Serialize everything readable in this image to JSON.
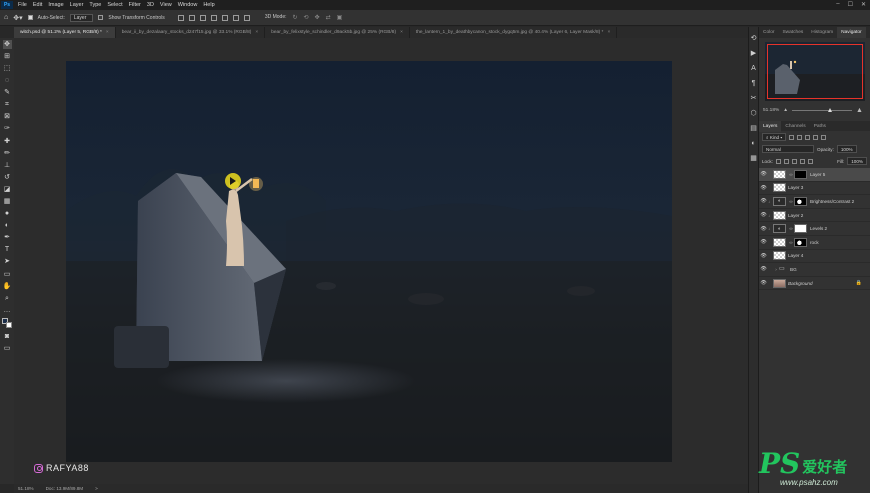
{
  "app": {
    "logo": "Ps"
  },
  "menu": [
    "File",
    "Edit",
    "Image",
    "Layer",
    "Type",
    "Select",
    "Filter",
    "3D",
    "View",
    "Window",
    "Help"
  ],
  "window_controls": [
    "–",
    "☐",
    "✕"
  ],
  "options_bar": {
    "auto_select_label": "Auto-Select:",
    "auto_select_target": "Layer",
    "transform_controls_label": "Show Transform Controls",
    "mode_3d_label": "3D Mode:"
  },
  "tabs": [
    {
      "label": "witch.psd @ 51.2% (Layer 5, RGB/8) *",
      "active": true
    },
    {
      "label": "bear_ii_by_dezalaary_stocks_d247f15.jpg @ 33.1% (RGB/8)",
      "active": false
    },
    {
      "label": "bear_by_felixstyle_schindler_d9ack5b.jpg @ 25% (RGB/8)",
      "active": false
    },
    {
      "label": "the_lantern_1_by_deathbycanon_stock_dygq5m.jpg @ 40.4% (Layer 6, Layer Mask/8) *",
      "active": false
    }
  ],
  "tools": [
    "move-icon",
    "artboard-icon",
    "marquee-icon",
    "lasso-icon",
    "quick-select-icon",
    "crop-icon",
    "frame-icon",
    "eyedropper-icon",
    "healing-icon",
    "brush-icon",
    "stamp-icon",
    "history-brush-icon",
    "eraser-icon",
    "gradient-icon",
    "blur-icon",
    "dodge-icon",
    "pen-icon",
    "type-icon",
    "path-select-icon",
    "shape-icon",
    "hand-icon",
    "zoom-icon",
    "more-icon"
  ],
  "tool_glyphs": [
    "✥",
    "⊞",
    "⬚",
    "◌",
    "✎",
    "⌗",
    "⊠",
    "✑",
    "✚",
    "✏",
    "⊥",
    "↺",
    "◪",
    "▦",
    "●",
    "◐",
    "✒",
    "T",
    "➤",
    "▭",
    "✋",
    "⌕",
    "…"
  ],
  "watermark": {
    "handle": "RAFYA88"
  },
  "status": {
    "zoom": "51.18%",
    "doc": "Doc: 13.9M/89.8M",
    "arrow": ">"
  },
  "panel_tabs": [
    {
      "label": "Color",
      "active": false
    },
    {
      "label": "Swatches",
      "active": false
    },
    {
      "label": "Histogram",
      "active": false
    },
    {
      "label": "Navigator",
      "active": true
    }
  ],
  "navigator": {
    "zoom": "51.18%"
  },
  "layer_tabs": [
    {
      "label": "Layers",
      "active": true
    },
    {
      "label": "Channels",
      "active": false
    },
    {
      "label": "Paths",
      "active": false
    }
  ],
  "layer_controls": {
    "kind_label": "Kind",
    "blend_mode": "Normal",
    "opacity_label": "Opacity:",
    "opacity_value": "100%",
    "lock_label": "Lock:",
    "fill_label": "Fill:",
    "fill_value": "100%"
  },
  "layers": [
    {
      "name": "Layer 5",
      "selected": true,
      "thumb": "image",
      "mask": "black",
      "clip": false
    },
    {
      "name": "Layer 3",
      "selected": false,
      "thumb": "image",
      "mask": null,
      "clip": false
    },
    {
      "name": "Brightness/Contrast 2",
      "selected": false,
      "thumb": "adjust",
      "mask": "blob",
      "clip": true
    },
    {
      "name": "Layer 2",
      "selected": false,
      "thumb": "image",
      "mask": null,
      "clip": true
    },
    {
      "name": "Levels 2",
      "selected": false,
      "thumb": "adjust",
      "mask": "white",
      "clip": true
    },
    {
      "name": "rock",
      "selected": false,
      "thumb": "image",
      "mask": "blob",
      "clip": false
    },
    {
      "name": "Layer 4",
      "selected": false,
      "thumb": "image",
      "mask": null,
      "clip": false
    },
    {
      "name": "BG",
      "selected": false,
      "thumb": "folder",
      "mask": null,
      "clip": false
    },
    {
      "name": "Background",
      "selected": false,
      "thumb": "background",
      "mask": null,
      "clip": false,
      "locked": true
    }
  ],
  "site_watermark": {
    "logo": "PS",
    "text": "爱好者",
    "url": "www.psahz.com"
  }
}
